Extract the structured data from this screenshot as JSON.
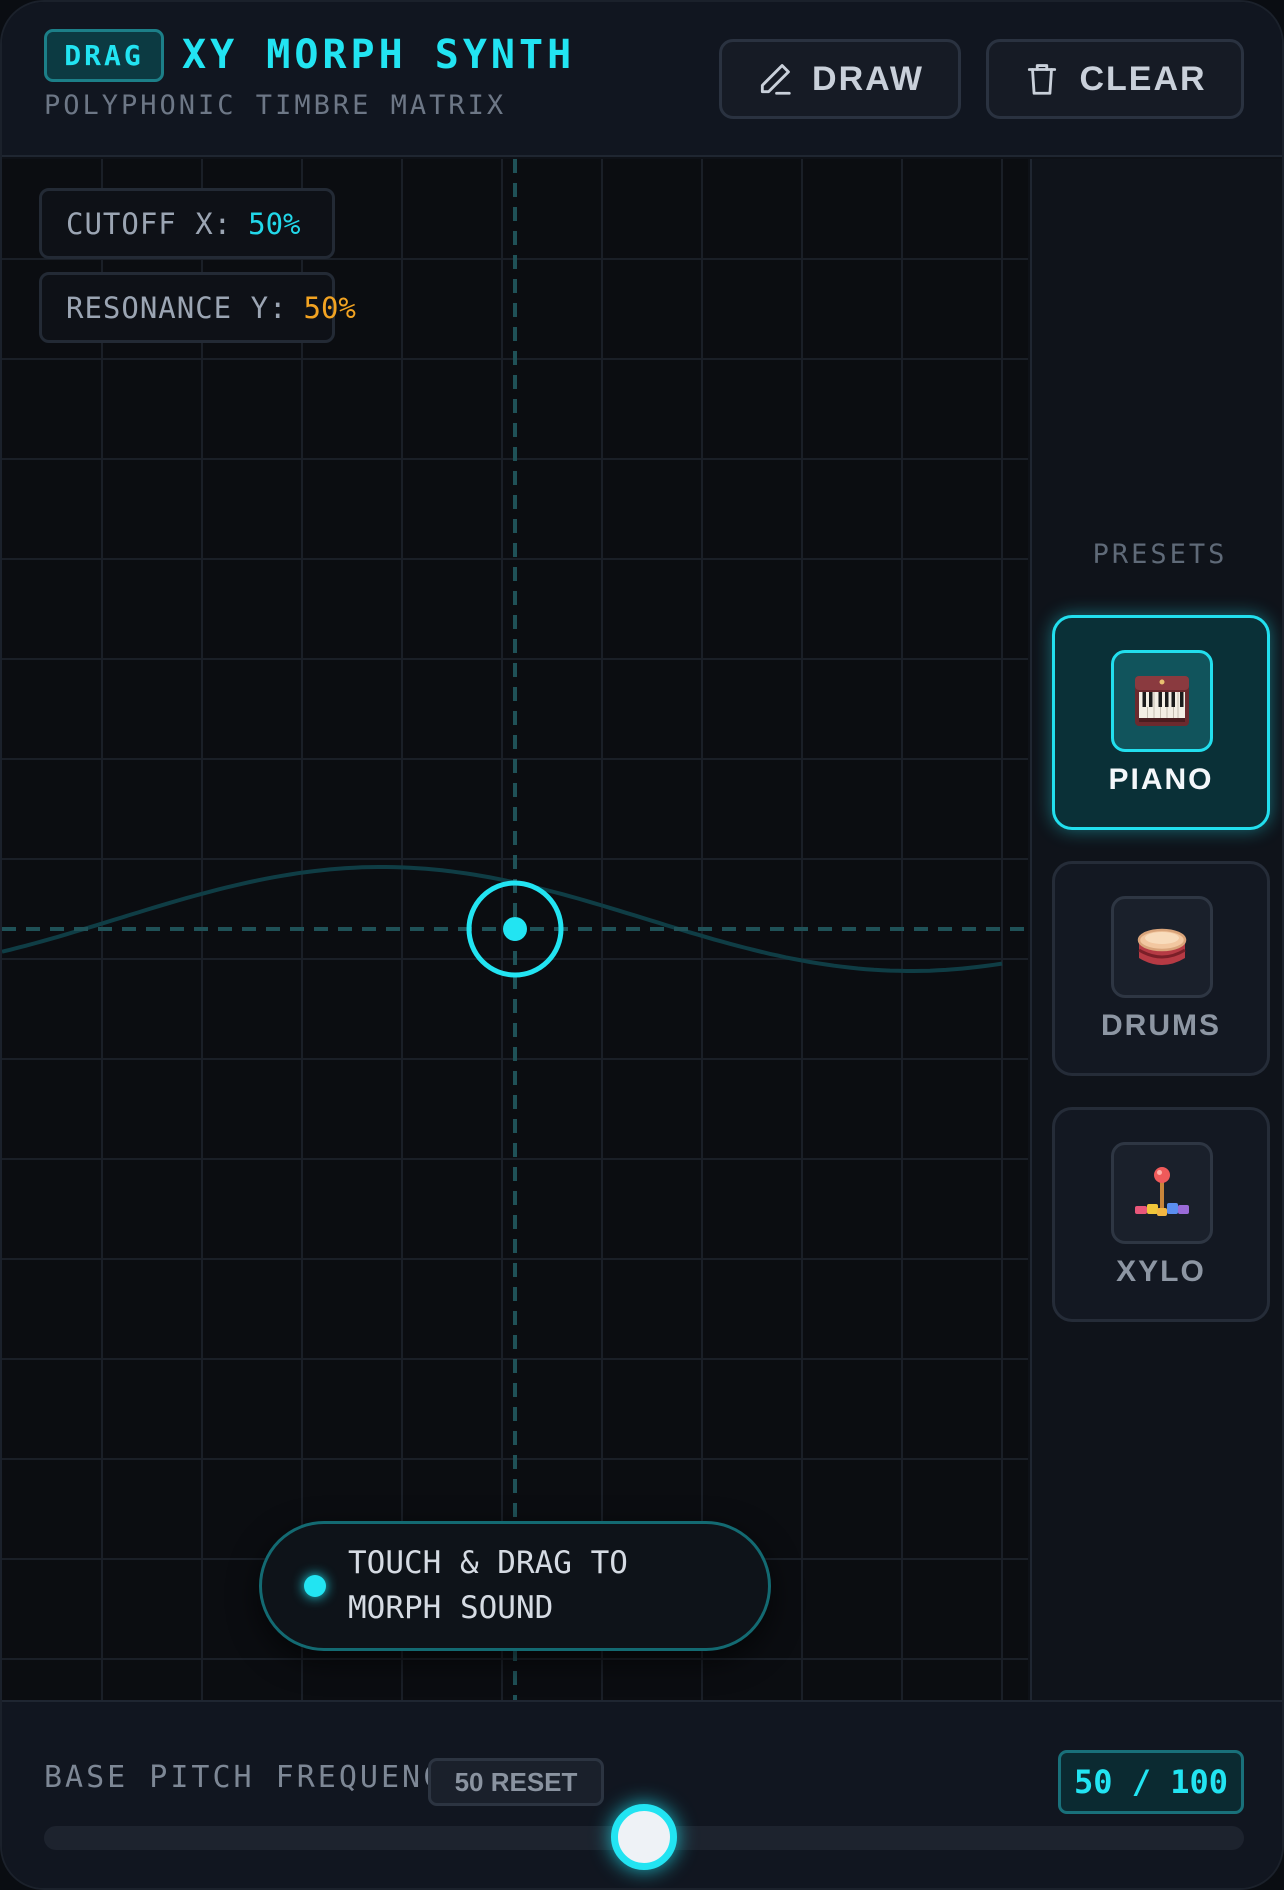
{
  "header": {
    "mode_badge": "DRAG",
    "title": "XY MORPH SYNTH",
    "subtitle": "POLYPHONIC TIMBRE MATRIX",
    "draw_label": "DRAW",
    "clear_label": "CLEAR",
    "draw_icon": "pencil-icon",
    "clear_icon": "trash-icon"
  },
  "pad": {
    "cutoff_label": "CUTOFF X:",
    "cutoff_value": "50%",
    "resonance_label": "RESONANCE Y:",
    "resonance_value": "50%",
    "cursor_x": 0.5,
    "cursor_y": 0.5,
    "hint": "TOUCH & DRAG TO MORPH SOUND"
  },
  "presets": {
    "title": "PRESETS",
    "items": [
      {
        "label": "PIANO",
        "icon": "piano-icon",
        "active": true
      },
      {
        "label": "DRUMS",
        "icon": "drum-icon",
        "active": false
      },
      {
        "label": "XYLO",
        "icon": "xylophone-icon",
        "active": false
      }
    ]
  },
  "footer": {
    "pitch_label": "BASE PITCH FREQUENCY",
    "reset_label": "50 RESET",
    "pitch_readout": "50 / 100",
    "pitch_value": 50,
    "pitch_max": 100
  },
  "colors": {
    "accent": "#22e4f2",
    "resonance": "#f2a322",
    "background": "#0b0d11"
  }
}
